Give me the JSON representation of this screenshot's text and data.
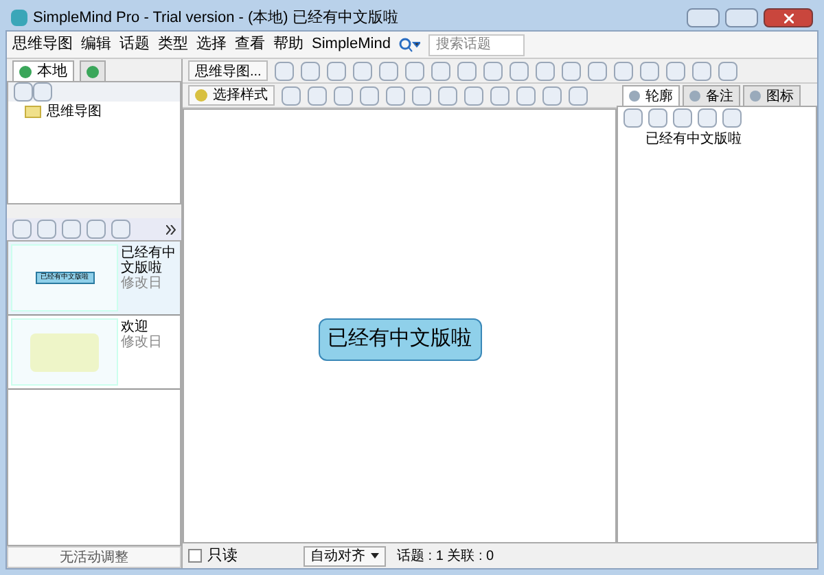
{
  "window": {
    "title": "SimpleMind Pro - Trial version - (本地) 已经有中文版啦"
  },
  "menu": [
    "思维导图",
    "编辑",
    "话题",
    "类型",
    "选择",
    "查看",
    "帮助",
    "SimpleMind"
  ],
  "search": {
    "placeholder": "搜索话题"
  },
  "left_tabs": [
    {
      "label": "本地",
      "selected": true
    },
    {
      "selected": false
    }
  ],
  "tree": [
    {
      "label": "思维导图",
      "selected": false
    }
  ],
  "thumbnails": [
    {
      "title": "已经有中文版啦",
      "node": "已经有中文版啦",
      "date": "修改日",
      "selected": true
    },
    {
      "title": "欢迎",
      "date": "修改日",
      "selected": false
    }
  ],
  "left_status": "无活动调整",
  "toolbar": {
    "mindmap_button": "思维导图...",
    "style_button": "选择样式"
  },
  "canvas": {
    "topic": "已经有中文版啦"
  },
  "right_tabs": [
    {
      "label": "轮廓",
      "selected": true
    },
    {
      "label": "备注",
      "selected": false
    },
    {
      "label": "图标",
      "selected": false
    }
  ],
  "outline": [
    "已经有中文版啦"
  ],
  "status_bar": {
    "readonly": {
      "label": "只读",
      "checked": false
    },
    "align": "自动对齐",
    "counts": "话题 : 1 关联 : 0"
  }
}
